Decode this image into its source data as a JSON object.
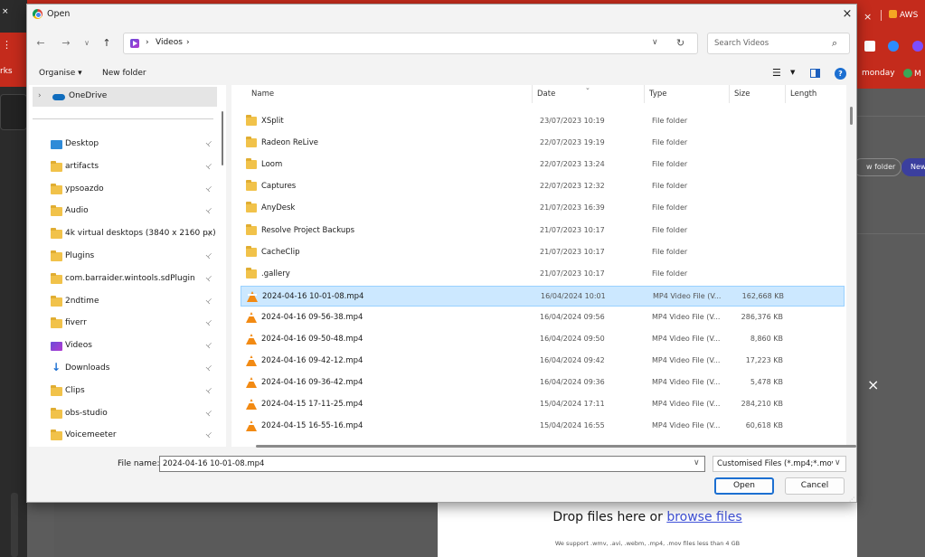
{
  "background": {
    "left_tab_text": "rks",
    "tab_close": "×",
    "tab_title": "AWS",
    "monday": "monday",
    "monday_badge": "M",
    "new_folder_partial": "w folder",
    "new_partial": "New",
    "overlay_close": "×",
    "drop_title": "Drop files here or",
    "drop_link": "browse files",
    "drop_sub": "We support .wmv, .avi, .webm, .mp4, .mov files less than 4 GB"
  },
  "dialog": {
    "title": "Open",
    "close": "×"
  },
  "nav": {
    "back": "←",
    "forward": "→",
    "recent": "∨",
    "up": "↑",
    "breadcrumb_sep1": "›",
    "breadcrumb_folder": "Videos",
    "breadcrumb_sep2": "›",
    "address_dropdown": "∨",
    "refresh": "↻",
    "search_placeholder": "Search Videos",
    "search_icon": "⌕"
  },
  "toolbar": {
    "organise": "Organise ▾",
    "new_folder": "New folder",
    "view_icon": "☰",
    "view_caret": "▼",
    "help": "?"
  },
  "sidebar": {
    "onedrive": {
      "chevron": "›",
      "label": "OneDrive"
    },
    "items": [
      {
        "label": "Desktop",
        "icon": "desktop-icon"
      },
      {
        "label": "artifacts",
        "icon": "folder-icon"
      },
      {
        "label": "ypsoazdo",
        "icon": "folder-icon"
      },
      {
        "label": "Audio",
        "icon": "folder-icon"
      },
      {
        "label": "4k virtual desktops (3840 x 2160 px)",
        "icon": "folder-icon"
      },
      {
        "label": "Plugins",
        "icon": "folder-icon"
      },
      {
        "label": "com.barraider.wintools.sdPlugin",
        "icon": "folder-icon"
      },
      {
        "label": "2ndtime",
        "icon": "folder-icon"
      },
      {
        "label": "fiverr",
        "icon": "folder-icon"
      },
      {
        "label": "Videos",
        "icon": "videos-icon"
      },
      {
        "label": "Downloads",
        "icon": "download-icon"
      },
      {
        "label": "Clips",
        "icon": "folder-icon"
      },
      {
        "label": "obs-studio",
        "icon": "folder-icon"
      },
      {
        "label": "Voicemeeter",
        "icon": "folder-icon"
      }
    ],
    "pin": "📌"
  },
  "files": {
    "columns": {
      "name": "Name",
      "date": "Date",
      "type": "Type",
      "size": "Size",
      "length": "Length",
      "sort_indicator": "⌄"
    },
    "rows": [
      {
        "name": "XSplit",
        "date": "23/07/2023 10:19",
        "type": "File folder",
        "size": "",
        "kind": "folder"
      },
      {
        "name": "Radeon ReLive",
        "date": "22/07/2023 19:19",
        "type": "File folder",
        "size": "",
        "kind": "folder"
      },
      {
        "name": "Loom",
        "date": "22/07/2023 13:24",
        "type": "File folder",
        "size": "",
        "kind": "folder"
      },
      {
        "name": "Captures",
        "date": "22/07/2023 12:32",
        "type": "File folder",
        "size": "",
        "kind": "folder"
      },
      {
        "name": "AnyDesk",
        "date": "21/07/2023 16:39",
        "type": "File folder",
        "size": "",
        "kind": "folder"
      },
      {
        "name": "Resolve Project Backups",
        "date": "21/07/2023 10:17",
        "type": "File folder",
        "size": "",
        "kind": "folder"
      },
      {
        "name": "CacheClip",
        "date": "21/07/2023 10:17",
        "type": "File folder",
        "size": "",
        "kind": "folder"
      },
      {
        "name": ".gallery",
        "date": "21/07/2023 10:17",
        "type": "File folder",
        "size": "",
        "kind": "folder"
      },
      {
        "name": "2024-04-16 10-01-08.mp4",
        "date": "16/04/2024 10:01",
        "type": "MP4 Video File (V...",
        "size": "162,668 KB",
        "kind": "video",
        "selected": true
      },
      {
        "name": "2024-04-16 09-56-38.mp4",
        "date": "16/04/2024 09:56",
        "type": "MP4 Video File (V...",
        "size": "286,376 KB",
        "kind": "video"
      },
      {
        "name": "2024-04-16 09-50-48.mp4",
        "date": "16/04/2024 09:50",
        "type": "MP4 Video File (V...",
        "size": "8,860 KB",
        "kind": "video"
      },
      {
        "name": "2024-04-16 09-42-12.mp4",
        "date": "16/04/2024 09:42",
        "type": "MP4 Video File (V...",
        "size": "17,223 KB",
        "kind": "video"
      },
      {
        "name": "2024-04-16 09-36-42.mp4",
        "date": "16/04/2024 09:36",
        "type": "MP4 Video File (V...",
        "size": "5,478 KB",
        "kind": "video"
      },
      {
        "name": "2024-04-15 17-11-25.mp4",
        "date": "15/04/2024 17:11",
        "type": "MP4 Video File (V...",
        "size": "284,210 KB",
        "kind": "video"
      },
      {
        "name": "2024-04-15 16-55-16.mp4",
        "date": "15/04/2024 16:55",
        "type": "MP4 Video File (V...",
        "size": "60,618 KB",
        "kind": "video"
      }
    ]
  },
  "footer": {
    "file_name_label": "File name:",
    "file_name_value": "2024-04-16 10-01-08.mp4",
    "filter_value": "Customised Files (*.mp4;*.mov",
    "dropdown": "∨",
    "open": "Open",
    "cancel": "Cancel"
  },
  "colors": {
    "accent": "#1c6fd1",
    "selection": "#cce8ff",
    "brand_red": "#c42b1c"
  }
}
